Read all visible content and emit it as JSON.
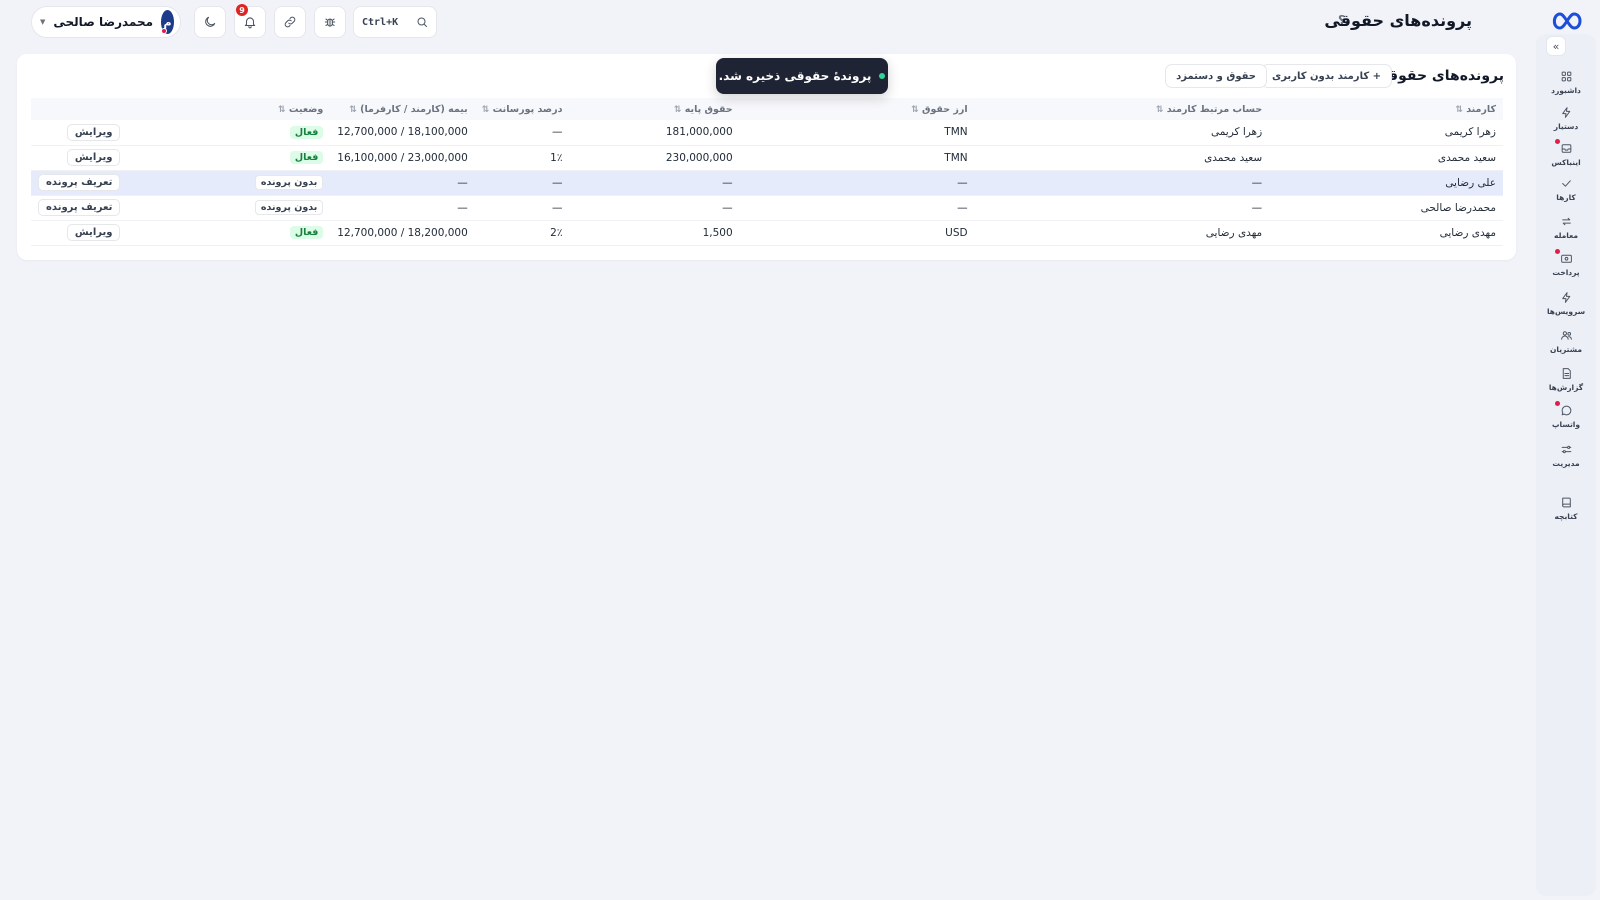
{
  "header": {
    "title": "پرونده‌های حقوقی",
    "help": "؟",
    "search_shortcut": "Ctrl+K",
    "notification_count": "9",
    "user": {
      "name": "محمدرضا صالحی",
      "initial": "م"
    }
  },
  "nav": {
    "items": [
      {
        "label": "داشبورد",
        "icon": "grid-icon",
        "dot": false
      },
      {
        "label": "دستیار",
        "icon": "bolt-icon",
        "dot": false
      },
      {
        "label": "اینباکس",
        "icon": "inbox-icon",
        "dot": true
      },
      {
        "label": "کارها",
        "icon": "check-icon",
        "dot": false
      },
      {
        "label": "معامله",
        "icon": "swap-icon",
        "dot": false
      },
      {
        "label": "پرداخت",
        "icon": "wallet-icon",
        "dot": true
      },
      {
        "label": "سرویس‌ها",
        "icon": "bolt-icon",
        "dot": false
      },
      {
        "label": "مشتریان",
        "icon": "users-icon",
        "dot": false
      },
      {
        "label": "گزارش‌ها",
        "icon": "report-icon",
        "dot": false
      },
      {
        "label": "واتساپ",
        "icon": "chat-icon",
        "dot": true
      },
      {
        "label": "مدیریت",
        "icon": "sliders-icon",
        "dot": false
      },
      {
        "label": "کتابچه",
        "icon": "book-icon",
        "dot": false
      }
    ]
  },
  "card": {
    "title": "پرونده‌های حقوقی",
    "add_employee_button": "+ کارمند بدون کاربری",
    "salary_button": "حقوق و دستمزد"
  },
  "toast": {
    "message": "پروندهٔ حقوقی ذخیره شد."
  },
  "table": {
    "columns": [
      "کارمند",
      "حساب مرتبط کارمند",
      "ارز حقوق",
      "حقوق پایه",
      "درصد پورسانت",
      "بیمه (کارمند / کارفرما)",
      "وضعیت",
      ""
    ],
    "sort_glyph": "⇅",
    "rows": [
      {
        "employee": "زهرا کریمی",
        "account": "زهرا کریمی",
        "currency": "TMN",
        "base": "181,000,000",
        "commission": "—",
        "insurance": "12,700,000 / 18,100,000",
        "status": "فعال",
        "status_type": "active",
        "action": "ویرایش",
        "highlight": false
      },
      {
        "employee": "سعید محمدی",
        "account": "سعید محمدی",
        "currency": "TMN",
        "base": "230,000,000",
        "commission": "1٪",
        "insurance": "16,100,000 / 23,000,000",
        "status": "فعال",
        "status_type": "active",
        "action": "ویرایش",
        "highlight": false
      },
      {
        "employee": "علی رضایی",
        "account": "—",
        "currency": "—",
        "base": "—",
        "commission": "—",
        "insurance": "—",
        "status": "بدون پرونده",
        "status_type": "none",
        "action": "تعریف پرونده",
        "highlight": true
      },
      {
        "employee": "محمدرضا صالحی",
        "account": "—",
        "currency": "—",
        "base": "—",
        "commission": "—",
        "insurance": "—",
        "status": "بدون پرونده",
        "status_type": "none",
        "action": "تعریف پرونده",
        "highlight": false
      },
      {
        "employee": "مهدی رضایی",
        "account": "مهدی رضایی",
        "currency": "USD",
        "base": "1,500",
        "commission": "2٪",
        "insurance": "12,700,000 / 18,200,000",
        "status": "فعال",
        "status_type": "active",
        "action": "ویرایش",
        "highlight": false
      }
    ]
  }
}
